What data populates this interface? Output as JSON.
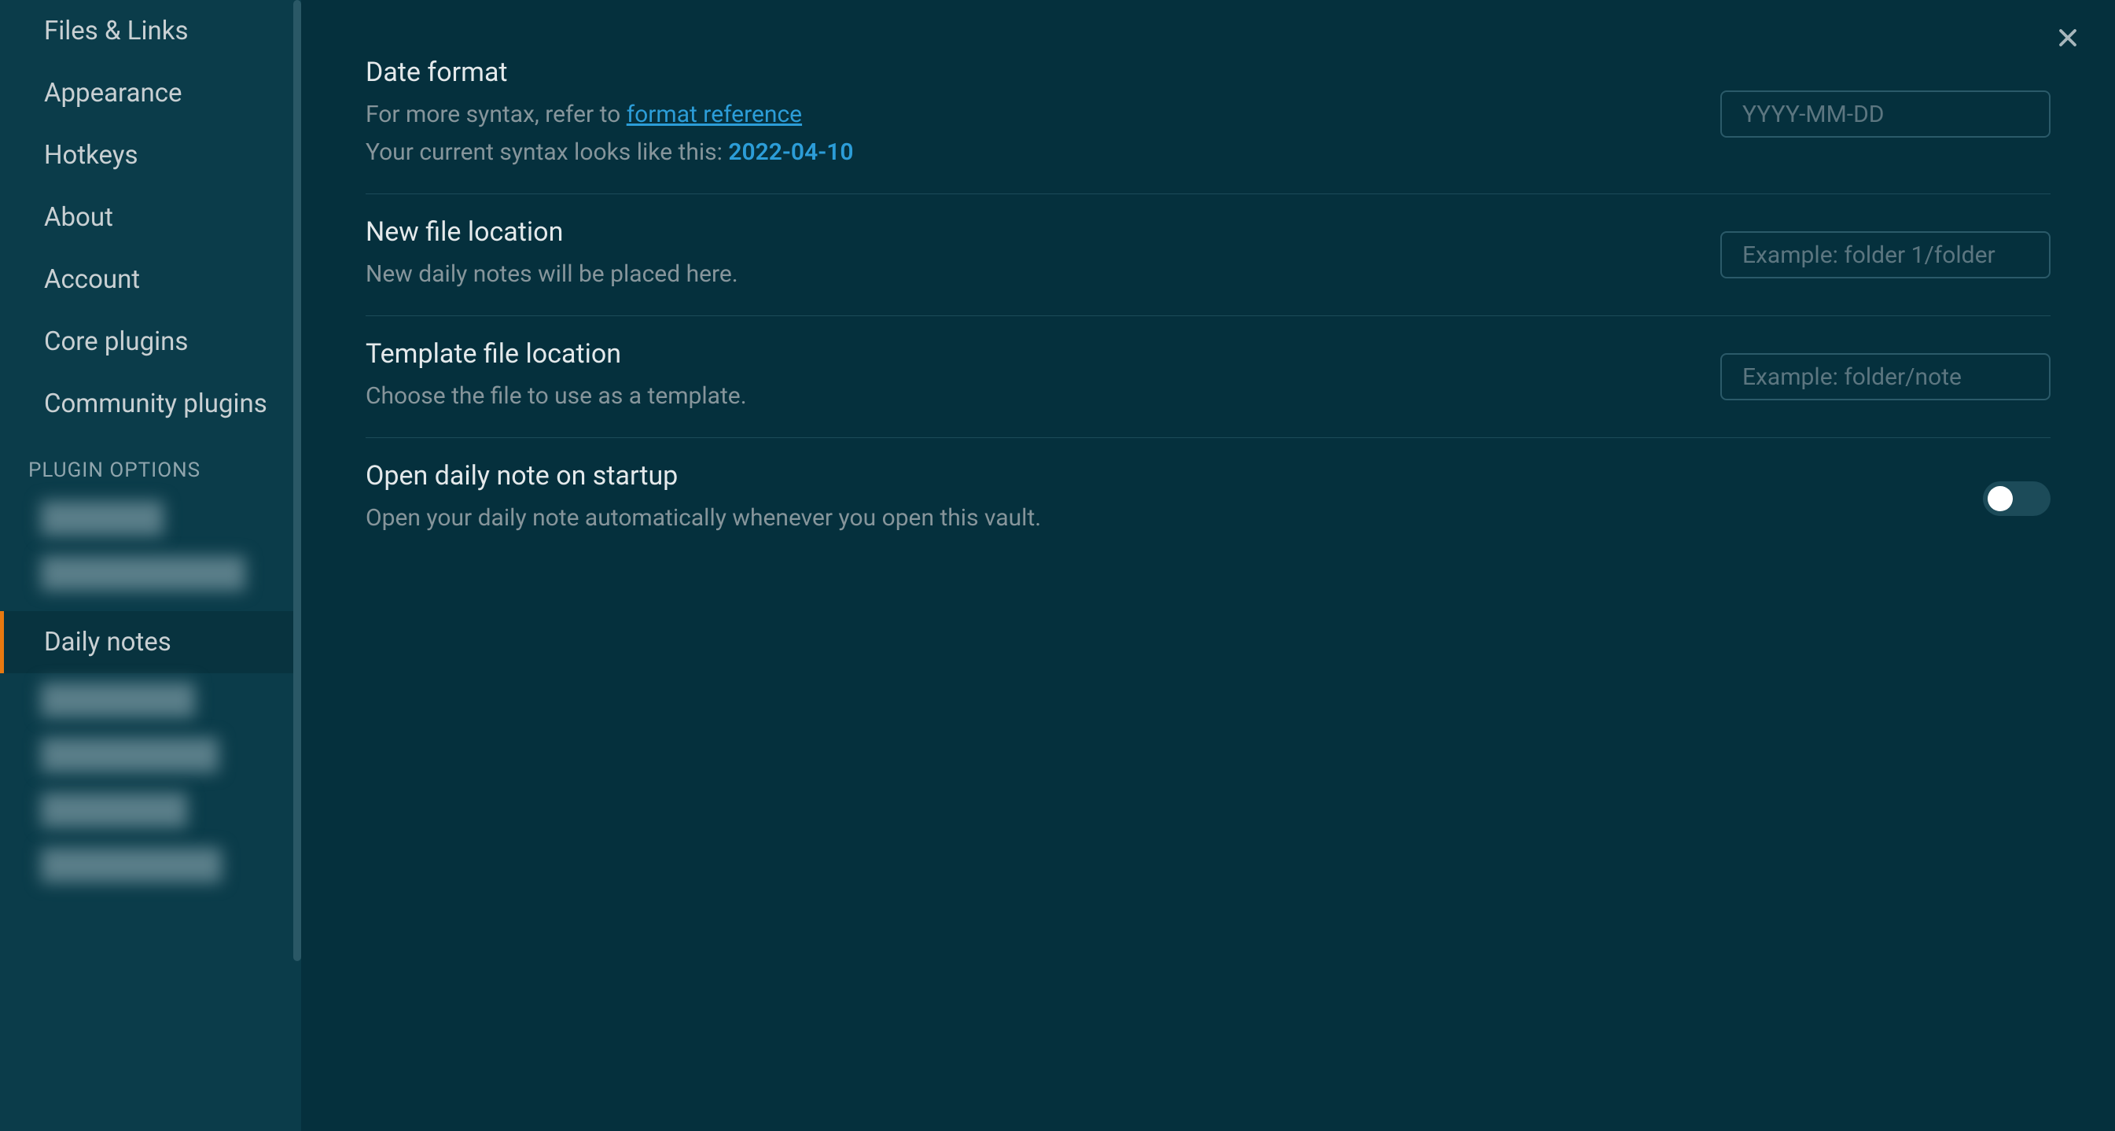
{
  "sidebar": {
    "items": [
      {
        "label": "Files & Links"
      },
      {
        "label": "Appearance"
      },
      {
        "label": "Hotkeys"
      },
      {
        "label": "About"
      },
      {
        "label": "Account"
      },
      {
        "label": "Core plugins"
      },
      {
        "label": "Community plugins"
      }
    ],
    "section_header": "PLUGIN OPTIONS",
    "active_item": "Daily notes"
  },
  "settings": {
    "date_format": {
      "title": "Date format",
      "desc_prefix": "For more syntax, refer to ",
      "link_text": "format reference",
      "desc2_prefix": "Your current syntax looks like this: ",
      "example": "2022-04-10",
      "placeholder": "YYYY-MM-DD",
      "value": ""
    },
    "new_file_location": {
      "title": "New file location",
      "desc": "New daily notes will be placed here.",
      "placeholder": "Example: folder 1/folder",
      "value": ""
    },
    "template_file_location": {
      "title": "Template file location",
      "desc": "Choose the file to use as a template.",
      "placeholder": "Example: folder/note",
      "value": ""
    },
    "open_on_startup": {
      "title": "Open daily note on startup",
      "desc": "Open your daily note automatically whenever you open this vault.",
      "enabled": false
    }
  }
}
